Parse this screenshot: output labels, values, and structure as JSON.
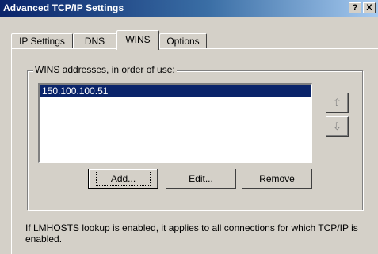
{
  "window": {
    "title": "Advanced TCP/IP Settings",
    "help_glyph": "?",
    "close_glyph": "X"
  },
  "tabs": [
    {
      "label": "IP Settings",
      "active": false
    },
    {
      "label": "DNS",
      "active": false
    },
    {
      "label": "WINS",
      "active": true
    },
    {
      "label": "Options",
      "active": false
    }
  ],
  "wins": {
    "group_label": "WINS addresses, in order of use:",
    "addresses": [
      "150.100.100.51"
    ],
    "selected_index": 0,
    "up_icon": "arrow-up-icon",
    "down_icon": "arrow-down-icon",
    "buttons": {
      "add": "Add...",
      "edit": "Edit...",
      "remove": "Remove"
    }
  },
  "info_text": "If LMHOSTS lookup is enabled, it applies to all connections for which TCP/IP is enabled.",
  "colors": {
    "titlebar_start": "#0a246a",
    "titlebar_end": "#a6caf0",
    "face": "#d4d0c8",
    "selection": "#0a246a"
  }
}
